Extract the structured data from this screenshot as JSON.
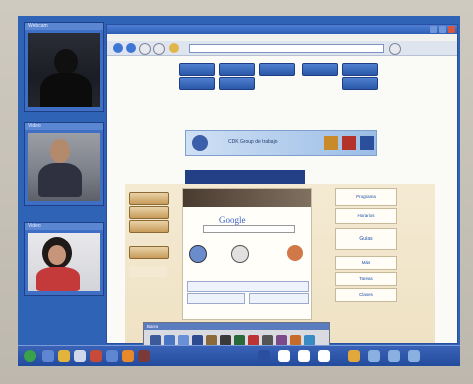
{
  "windows": {
    "self_video": {
      "title": "Webcam"
    },
    "remote_video_1": {
      "title": "Video"
    },
    "remote_video_2": {
      "title": "Video"
    }
  },
  "browser": {
    "title": "",
    "menu": "",
    "address": "",
    "menu_buttons": [
      "",
      "",
      "",
      "",
      "",
      "",
      "",
      ""
    ],
    "banner_text": "CDK Group de trabajo",
    "side_buttons": [
      "",
      "",
      "",
      "",
      ""
    ],
    "google_label": "Google",
    "center_buttons": [
      "",
      "",
      ""
    ],
    "right_links": [
      "Programa",
      "Horarios",
      "Guías",
      "Más",
      "Tareas",
      "Clases"
    ]
  },
  "quicklaunch": {
    "title": "Barra"
  },
  "taskbar": {
    "clock": ""
  },
  "colors": {
    "desktop": "#2f63b6",
    "browser_bg": "#fafaf6",
    "accent": "#2b58a8"
  }
}
